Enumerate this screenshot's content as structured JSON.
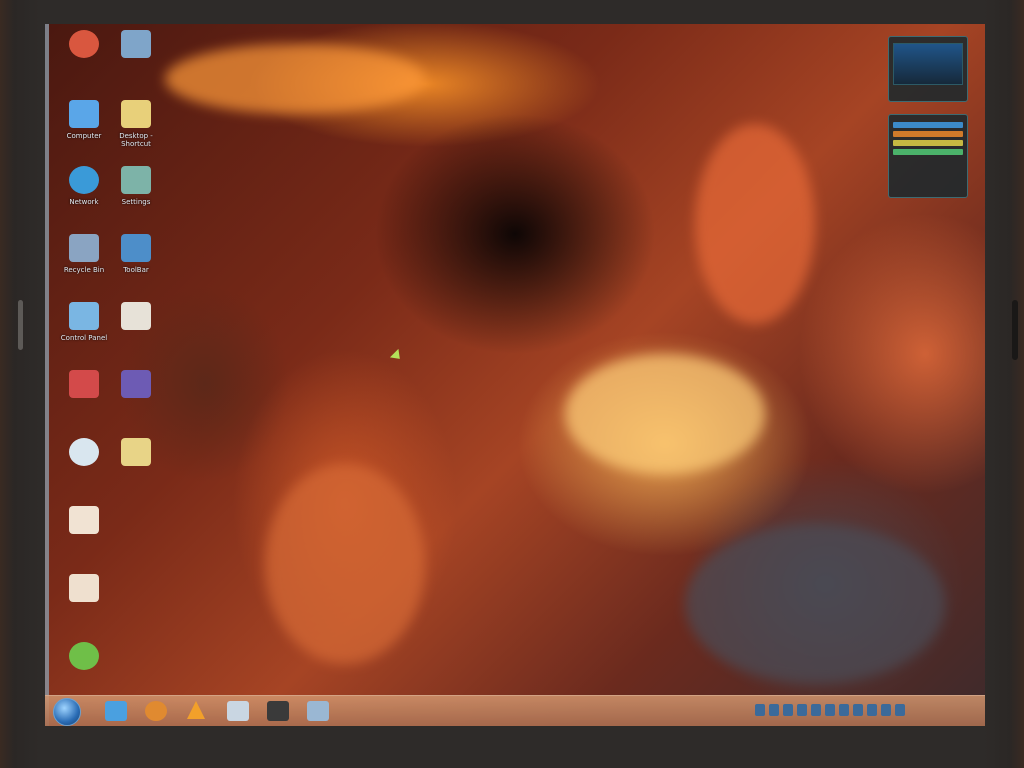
{
  "desktop": {
    "icons": [
      {
        "name": "recycle-bin-top",
        "label": "",
        "color": "#d9573f"
      },
      {
        "name": "app-top-2",
        "label": "",
        "color": "#7fa5c9"
      },
      {
        "name": "computer",
        "label": "Computer",
        "color": "#5aa6e8"
      },
      {
        "name": "desktop-shortcut",
        "label": "Desktop - Shortcut",
        "color": "#e8d07a"
      },
      {
        "name": "network",
        "label": "Network",
        "color": "#3a9ad8"
      },
      {
        "name": "settings",
        "label": "Settings",
        "color": "#7db3a8"
      },
      {
        "name": "recycle-bin",
        "label": "Recycle Bin",
        "color": "#8aa4c2"
      },
      {
        "name": "toolbar",
        "label": "ToolBar",
        "color": "#4d8ec9"
      },
      {
        "name": "control-panel",
        "label": "Control Panel",
        "color": "#7ab6e3"
      },
      {
        "name": "app-6",
        "label": "",
        "color": "#e7e2d8"
      },
      {
        "name": "app-7",
        "label": "",
        "color": "#d34a4a"
      },
      {
        "name": "app-8",
        "label": "",
        "color": "#6d5bb4"
      },
      {
        "name": "app-9",
        "label": "",
        "color": "#d9e6ef"
      },
      {
        "name": "app-10",
        "label": "",
        "color": "#e8d487"
      },
      {
        "name": "app-11",
        "label": "",
        "color": "#f1e3d3"
      },
      {
        "name": "app-12",
        "label": "",
        "color": "#efe0cf"
      },
      {
        "name": "app-13",
        "label": "",
        "color": "#6fbf48"
      }
    ]
  },
  "gadgets": {
    "cpu": {
      "title": "",
      "value": ""
    },
    "network": {
      "title": "",
      "rows": [
        "",
        "",
        "",
        ""
      ]
    }
  },
  "taskbar": {
    "start_label": "",
    "clock_time": "",
    "clock_date": "",
    "items": [
      {
        "name": "ie",
        "color": "#4aa0e0"
      },
      {
        "name": "firefox",
        "color": "#e08a30"
      },
      {
        "name": "vlc",
        "color": "#f2a02a"
      },
      {
        "name": "app-4",
        "color": "#c9d6e2"
      },
      {
        "name": "app-5",
        "color": "#3a3a3a"
      },
      {
        "name": "app-6",
        "color": "#9ab7d3"
      }
    ]
  },
  "colors": {
    "accent": "#2a6cb5",
    "taskbar": "#c28a62",
    "gadget_border": "#3e6b72"
  }
}
